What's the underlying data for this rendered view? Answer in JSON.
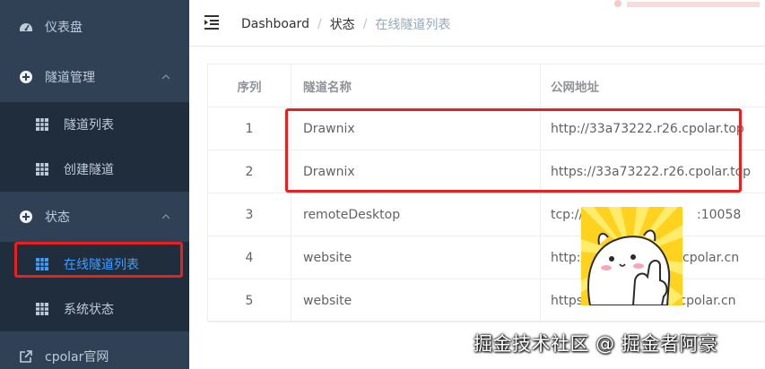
{
  "sidebar": {
    "items": [
      {
        "label": "仪表盘",
        "icon": "dashboard-icon"
      },
      {
        "label": "隧道管理",
        "icon": "plus-circle-icon",
        "children": [
          {
            "label": "隧道列表",
            "icon": "table-icon"
          },
          {
            "label": "创建隧道",
            "icon": "table-icon"
          }
        ]
      },
      {
        "label": "状态",
        "icon": "plus-circle-icon",
        "children": [
          {
            "label": "在线隧道列表",
            "icon": "table-icon",
            "active": true
          },
          {
            "label": "系统状态",
            "icon": "table-icon"
          }
        ]
      },
      {
        "label": "cpolar官网",
        "icon": "external-link-icon"
      }
    ]
  },
  "header": {
    "breadcrumb": [
      "Dashboard",
      "状态",
      "在线隧道列表"
    ],
    "separator": "/"
  },
  "table": {
    "columns": [
      "序列",
      "隧道名称",
      "公网地址"
    ],
    "rows": [
      {
        "index": "1",
        "name": "Drawnix",
        "url": "http://33a73222.r26.cpolar.top"
      },
      {
        "index": "2",
        "name": "Drawnix",
        "url": "https://33a73222.r26.cpolar.top"
      },
      {
        "index": "3",
        "name": "remoteDesktop",
        "url": "tcp://1",
        "url_tail": ":10058"
      },
      {
        "index": "4",
        "name": "website",
        "url": "http://",
        "url_tail": "cpolar.cn"
      },
      {
        "index": "5",
        "name": "website",
        "url": "https:",
        "url_tail": ".cpolar.cn"
      }
    ]
  },
  "watermark": "掘金技术社区 @ 掘金者阿豪",
  "colors": {
    "sidebar_bg": "#304156",
    "submenu_bg": "#1f2d3d",
    "active": "#409eff",
    "highlight_box": "#e8201f"
  }
}
